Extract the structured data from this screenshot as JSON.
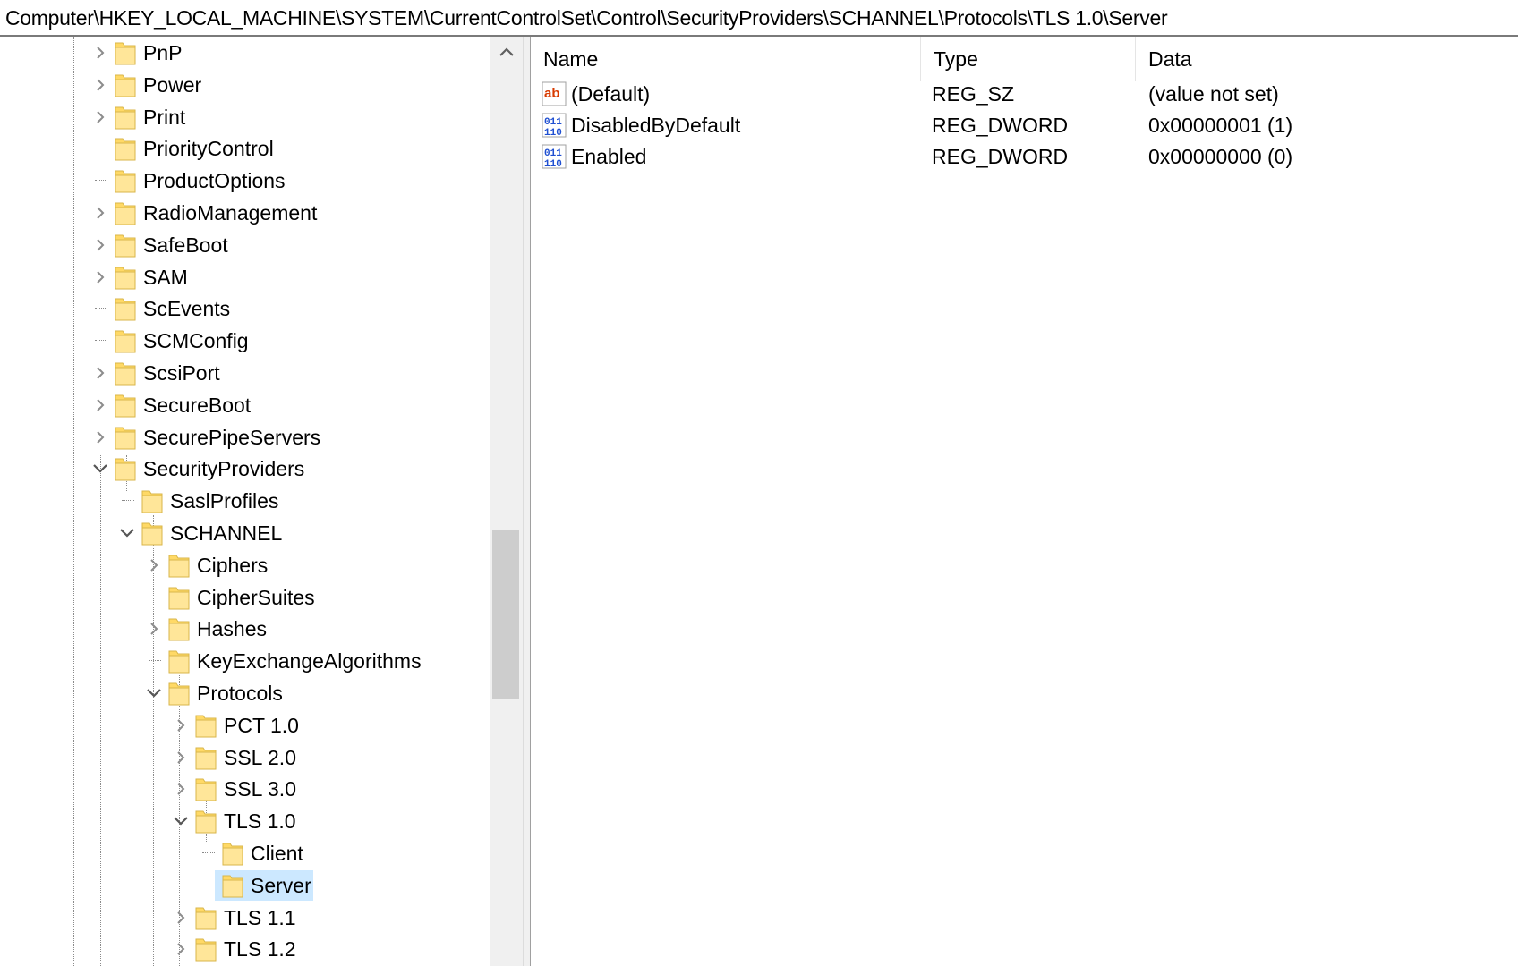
{
  "address": "Computer\\HKEY_LOCAL_MACHINE\\SYSTEM\\CurrentControlSet\\Control\\SecurityProviders\\SCHANNEL\\Protocols\\TLS 1.0\\Server",
  "tree": {
    "items": [
      {
        "label": "PnP",
        "expander": "collapsed"
      },
      {
        "label": "Power",
        "expander": "collapsed"
      },
      {
        "label": "Print",
        "expander": "collapsed"
      },
      {
        "label": "PriorityControl",
        "expander": "none"
      },
      {
        "label": "ProductOptions",
        "expander": "none"
      },
      {
        "label": "RadioManagement",
        "expander": "collapsed"
      },
      {
        "label": "SafeBoot",
        "expander": "collapsed"
      },
      {
        "label": "SAM",
        "expander": "collapsed"
      },
      {
        "label": "ScEvents",
        "expander": "none"
      },
      {
        "label": "SCMConfig",
        "expander": "none"
      },
      {
        "label": "ScsiPort",
        "expander": "collapsed"
      },
      {
        "label": "SecureBoot",
        "expander": "collapsed"
      },
      {
        "label": "SecurePipeServers",
        "expander": "collapsed"
      },
      {
        "label": "SecurityProviders",
        "expander": "expanded"
      },
      {
        "label": "SaslProfiles",
        "expander": "none"
      },
      {
        "label": "SCHANNEL",
        "expander": "expanded"
      },
      {
        "label": "Ciphers",
        "expander": "collapsed"
      },
      {
        "label": "CipherSuites",
        "expander": "none"
      },
      {
        "label": "Hashes",
        "expander": "collapsed"
      },
      {
        "label": "KeyExchangeAlgorithms",
        "expander": "none"
      },
      {
        "label": "Protocols",
        "expander": "expanded"
      },
      {
        "label": "PCT 1.0",
        "expander": "collapsed"
      },
      {
        "label": "SSL 2.0",
        "expander": "collapsed"
      },
      {
        "label": "SSL 3.0",
        "expander": "collapsed"
      },
      {
        "label": "TLS 1.0",
        "expander": "expanded"
      },
      {
        "label": "Client",
        "expander": "none"
      },
      {
        "label": "Server",
        "expander": "none",
        "selected": true
      },
      {
        "label": "TLS 1.1",
        "expander": "collapsed"
      },
      {
        "label": "TLS 1.2",
        "expander": "collapsed"
      }
    ],
    "selected_highlight_color": "#cce8ff",
    "folder_color": "#ffd966"
  },
  "list": {
    "columns": {
      "name": "Name",
      "type": "Type",
      "data": "Data"
    },
    "rows": [
      {
        "icon": "string-value-icon",
        "name": "(Default)",
        "type": "REG_SZ",
        "data": "(value not set)"
      },
      {
        "icon": "binary-value-icon",
        "name": "DisabledByDefault",
        "type": "REG_DWORD",
        "data": "0x00000001 (1)"
      },
      {
        "icon": "binary-value-icon",
        "name": "Enabled",
        "type": "REG_DWORD",
        "data": "0x00000000 (0)"
      }
    ]
  },
  "scrollbar": {
    "up_arrow": "chevron-up-icon"
  }
}
